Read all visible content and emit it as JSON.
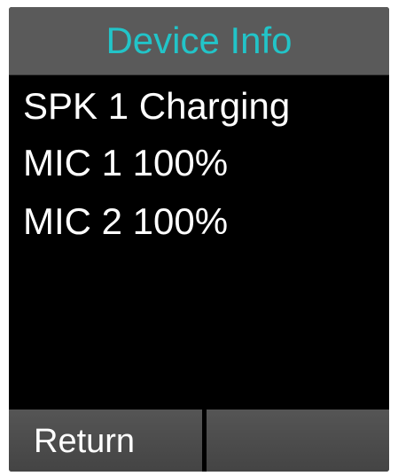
{
  "header": {
    "title": "Device Info"
  },
  "device_list": {
    "items": [
      {
        "label": "SPK 1 Charging"
      },
      {
        "label": "MIC 1 100%"
      },
      {
        "label": "MIC 2 100%"
      }
    ]
  },
  "softkeys": {
    "left_label": "Return",
    "right_label": ""
  },
  "colors": {
    "title_accent": "#22c4c8",
    "titlebar_bg": "#5a5a5a",
    "screen_bg": "#000000",
    "softkey_bg": "#4a4a4a",
    "text": "#ffffff"
  }
}
